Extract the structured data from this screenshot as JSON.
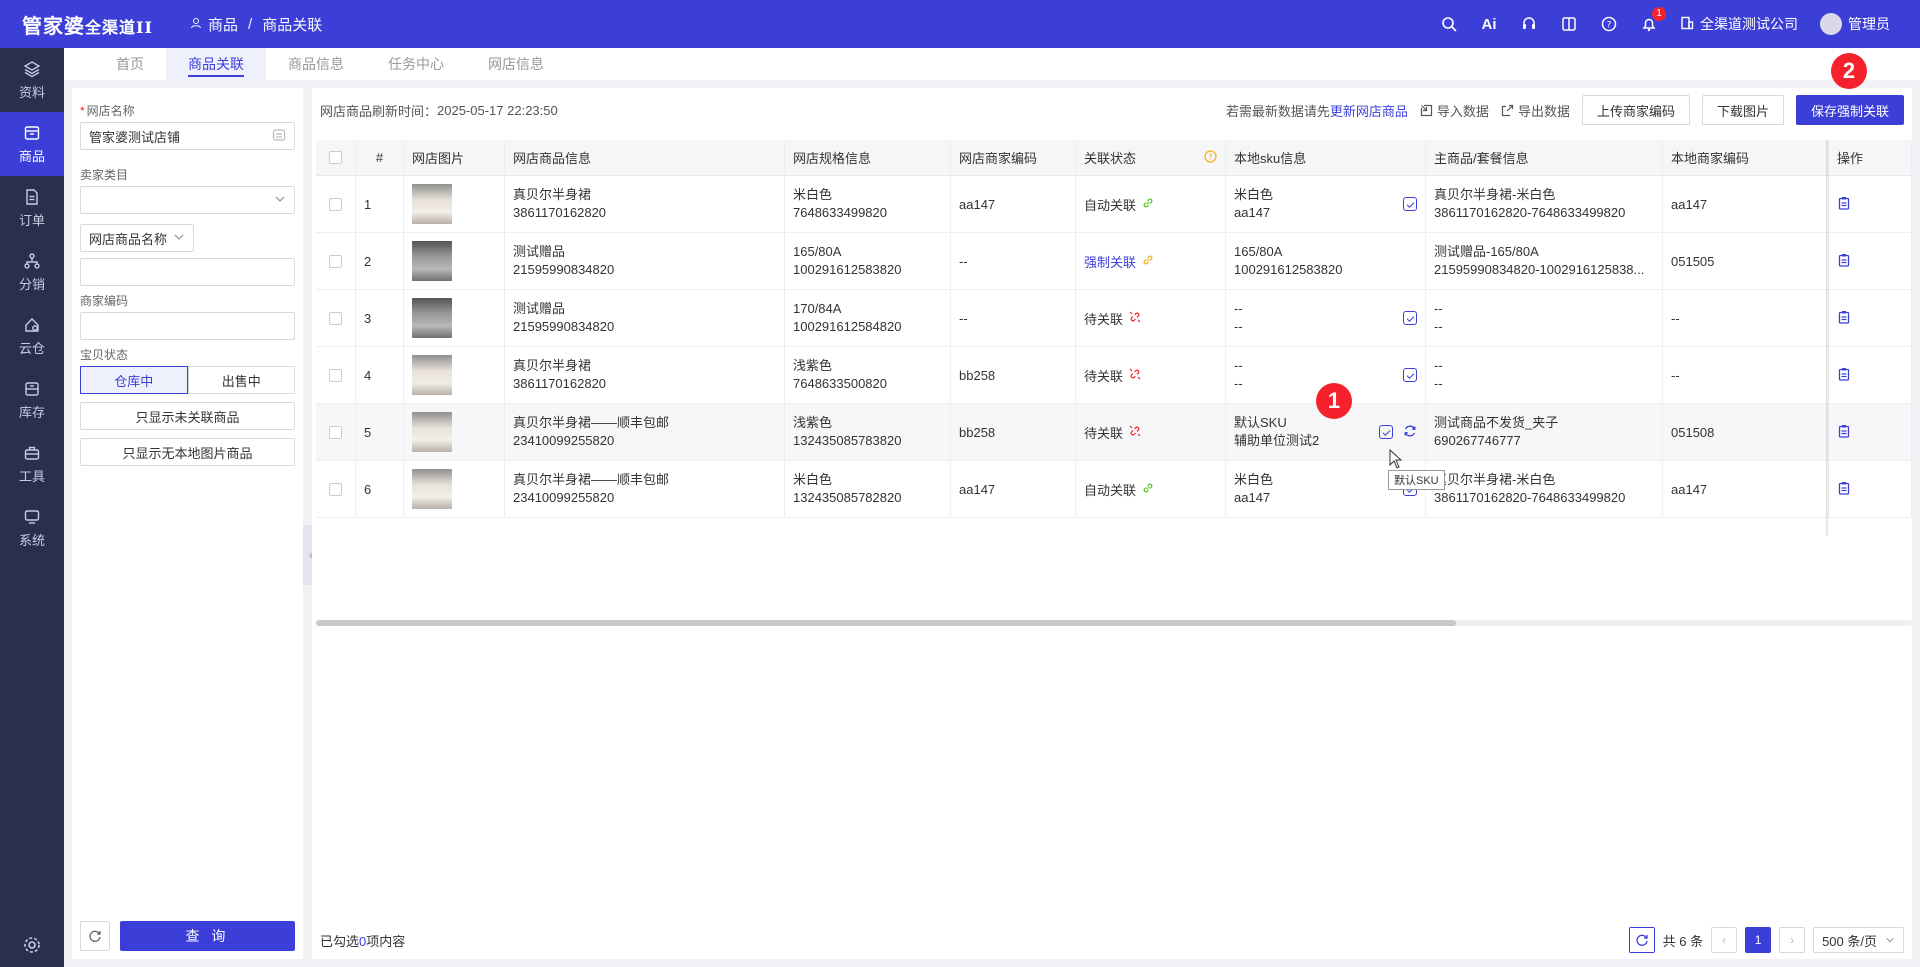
{
  "app": {
    "logo_main": "管家婆",
    "logo_sub": "全渠道II",
    "breadcrumb_root": "商品",
    "breadcrumb_sep": "/",
    "breadcrumb_current": "商品关联",
    "ai_label": "Ai",
    "notification_count": "1",
    "company": "全渠道测试公司",
    "user": "管理员"
  },
  "nav": [
    {
      "label": "资料",
      "icon": "layers-icon"
    },
    {
      "label": "商品",
      "icon": "box-icon",
      "active": true
    },
    {
      "label": "订单",
      "icon": "document-icon"
    },
    {
      "label": "分销",
      "icon": "network-icon"
    },
    {
      "label": "云仓",
      "icon": "cloud-home-icon"
    },
    {
      "label": "库存",
      "icon": "inventory-icon"
    },
    {
      "label": "工具",
      "icon": "toolbox-icon"
    },
    {
      "label": "系统",
      "icon": "monitor-icon"
    }
  ],
  "tabs": [
    "首页",
    "商品关联",
    "商品信息",
    "任务中心",
    "网店信息"
  ],
  "filter": {
    "shop_label": "网店名称",
    "shop_value": "管家婆测试店铺",
    "category_label": "卖家类目",
    "name_select": "网店商品名称",
    "code_label": "商家编码",
    "status_label": "宝贝状态",
    "status_in_stock": "仓库中",
    "status_on_sale": "出售中",
    "btn_unlinked": "只显示未关联商品",
    "btn_no_image": "只显示无本地图片商品",
    "query_label": "查 询"
  },
  "toolbar": {
    "refresh_time_label": "网店商品刷新时间：",
    "refresh_time": "2025-05-17 22:23:50",
    "hint_prefix": "若需最新数据请先",
    "hint_link": "更新网店商品",
    "import": "导入数据",
    "export": "导出数据",
    "upload": "上传商家编码",
    "download": "下载图片",
    "save": "保存强制关联"
  },
  "columns": [
    "#",
    "网店图片",
    "网店商品信息",
    "网店规格信息",
    "网店商家编码",
    "关联状态",
    "本地sku信息",
    "主商品/套餐信息",
    "本地商家编码",
    "操作"
  ],
  "rows": [
    {
      "no": "1",
      "name": "真贝尔半身裙",
      "id": "3861170162820",
      "spec": "米白色",
      "spec_id": "7648633499820",
      "code": "aa147",
      "status": "自动关联",
      "status_type": "auto",
      "sku1": "米白色",
      "sku2": "aa147",
      "main1": "真贝尔半身裙-米白色",
      "main2": "3861170162820-7648633499820",
      "local_code": "aa147"
    },
    {
      "no": "2",
      "name": "测试赠品",
      "id": "21595990834820",
      "spec": "165/80A",
      "spec_id": "100291612583820",
      "code": "--",
      "status": "强制关联",
      "status_type": "force",
      "sku1": "165/80A",
      "sku2": "100291612583820",
      "main1": "测试赠品-165/80A",
      "main2": "21595990834820-1002916125838...",
      "local_code": "051505"
    },
    {
      "no": "3",
      "name": "测试赠品",
      "id": "21595990834820",
      "spec": "170/84A",
      "spec_id": "100291612584820",
      "code": "--",
      "status": "待关联",
      "status_type": "pending",
      "sku1": "--",
      "sku2": "--",
      "main1": "--",
      "main2": "--",
      "local_code": "--"
    },
    {
      "no": "4",
      "name": "真贝尔半身裙",
      "id": "3861170162820",
      "spec": "浅紫色",
      "spec_id": "7648633500820",
      "code": "bb258",
      "status": "待关联",
      "status_type": "pending",
      "sku1": "--",
      "sku2": "--",
      "main1": "--",
      "main2": "--",
      "local_code": "--"
    },
    {
      "no": "5",
      "name": "真贝尔半身裙——顺丰包邮",
      "id": "23410099255820",
      "spec": "浅紫色",
      "spec_id": "132435085783820",
      "code": "bb258",
      "status": "待关联",
      "status_type": "pending",
      "sku1": "默认SKU",
      "sku2": "辅助单位测试2",
      "main1": "测试商品不发货_夹子",
      "main2": "690267746777",
      "local_code": "051508"
    },
    {
      "no": "6",
      "name": "真贝尔半身裙——顺丰包邮",
      "id": "23410099255820",
      "spec": "米白色",
      "spec_id": "132435085782820",
      "code": "aa147",
      "status": "自动关联",
      "status_type": "auto",
      "sku1": "米白色",
      "sku2": "aa147",
      "main1": "真贝尔半身裙-米白色",
      "main2": "3861170162820-7648633499820",
      "local_code": "aa147"
    }
  ],
  "tooltip": "默认SKU",
  "callouts": [
    "1",
    "2"
  ],
  "footer": {
    "selected_prefix": "已勾选",
    "selected_count": "0",
    "selected_suffix": "项内容",
    "total": "共 6 条",
    "page": "1",
    "page_size": "500 条/页"
  },
  "colors": {
    "primary": "#3b3fd8",
    "nav_bg": "#2b2f4e",
    "auto": "#52c41a",
    "pending": "#f5222d",
    "force": "#faad14"
  }
}
